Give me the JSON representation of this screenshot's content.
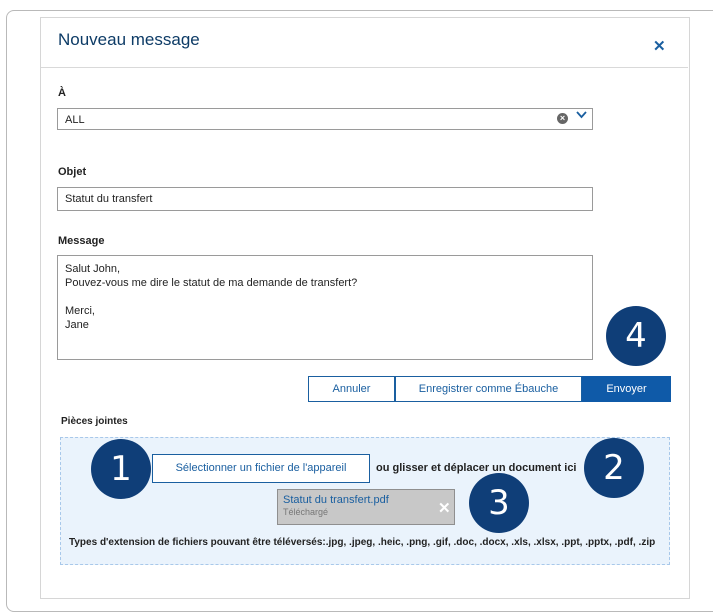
{
  "dialog": {
    "title": "Nouveau message",
    "close_icon": "close-icon"
  },
  "to": {
    "label": "À",
    "value": "ALL",
    "clear_icon": "clear-circle-icon",
    "dropdown_icon": "chevron-down-icon"
  },
  "subject": {
    "label": "Objet",
    "value": "Statut du transfert"
  },
  "message": {
    "label": "Message",
    "lines": [
      "Salut John,",
      "Pouvez-vous me dire le statut de ma demande de transfert?",
      "",
      "Merci,",
      "Jane"
    ]
  },
  "actions": {
    "cancel": "Annuler",
    "draft": "Enregistrer comme Ébauche",
    "send": "Envoyer"
  },
  "attachments": {
    "label": "Pièces jointes",
    "select_button": "Sélectionner un fichier de l'appareil",
    "drag_text": "ou glisser et déplacer un document ici",
    "file": {
      "name": "Statut du transfert.pdf",
      "status": "Téléchargé",
      "remove_icon": "close-icon"
    },
    "types_text": "Types d'extension de fichiers pouvant être téléversés:.jpg, .jpeg, .heic, .png, .gif, .doc, .docx, .xls, .xlsx, .ppt, .pptx, .pdf, .zip"
  },
  "callouts": [
    "1",
    "2",
    "3",
    "4"
  ],
  "colors": {
    "accent": "#0f5aa8",
    "badge": "#0f3e78",
    "dropzone": "#eaf3fc"
  }
}
